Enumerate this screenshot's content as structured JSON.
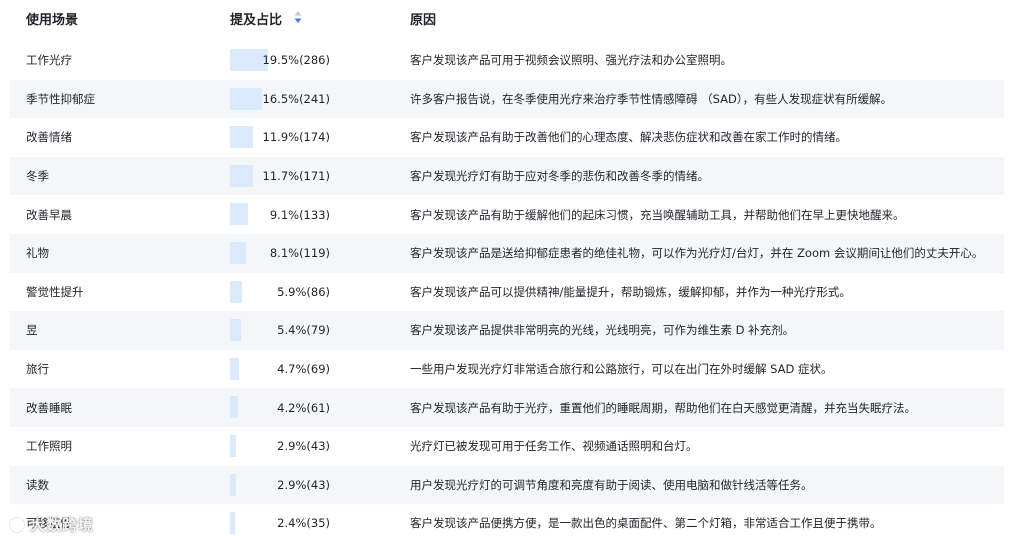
{
  "header": {
    "col_scene": "使用场景",
    "col_share": "提及占比",
    "col_reason": "原因"
  },
  "colors": {
    "bar": "#dbe9fd",
    "sort_up": "#c5c9d1",
    "sort_down": "#3d7cf5",
    "row_shade": "#f5f6f8"
  },
  "watermark": "大数跨境",
  "rows": [
    {
      "scene": "工作光疗",
      "share": "19.5%(286)",
      "percent": 19.5,
      "reason": "客户发现该产品可用于视频会议照明、强光疗法和办公室照明。"
    },
    {
      "scene": "季节性抑郁症",
      "share": "16.5%(241)",
      "percent": 16.5,
      "reason": "许多客户报告说，在冬季使用光疗来治疗季节性情感障碍 （SAD），有些人发现症状有所缓解。"
    },
    {
      "scene": "改善情绪",
      "share": "11.9%(174)",
      "percent": 11.9,
      "reason": "客户发现该产品有助于改善他们的心理态度、解决悲伤症状和改善在家工作时的情绪。"
    },
    {
      "scene": "冬季",
      "share": "11.7%(171)",
      "percent": 11.7,
      "reason": "客户发现光疗灯有助于应对冬季的悲伤和改善冬季的情绪。"
    },
    {
      "scene": "改善早晨",
      "share": "9.1%(133)",
      "percent": 9.1,
      "reason": "客户发现该产品有助于缓解他们的起床习惯，充当唤醒辅助工具，并帮助他们在早上更快地醒来。"
    },
    {
      "scene": "礼物",
      "share": "8.1%(119)",
      "percent": 8.1,
      "reason": "客户发现该产品是送给抑郁症患者的绝佳礼物，可以作为光疗灯/台灯，并在 Zoom 会议期间让他们的丈夫开心。"
    },
    {
      "scene": "警觉性提升",
      "share": "5.9%(86)",
      "percent": 5.9,
      "reason": "客户发现该产品可以提供精神/能量提升，帮助锻炼，缓解抑郁，并作为一种光疗形式。"
    },
    {
      "scene": "昱",
      "share": "5.4%(79)",
      "percent": 5.4,
      "reason": "客户发现该产品提供非常明亮的光线，光线明亮，可作为维生素 D 补充剂。"
    },
    {
      "scene": "旅行",
      "share": "4.7%(69)",
      "percent": 4.7,
      "reason": "一些用户发现光疗灯非常适合旅行和公路旅行，可以在出门在外时缓解 SAD 症状。"
    },
    {
      "scene": "改善睡眠",
      "share": "4.2%(61)",
      "percent": 4.2,
      "reason": "客户发现该产品有助于光疗，重置他们的睡眠周期，帮助他们在白天感觉更清醒，并充当失眠疗法。"
    },
    {
      "scene": "工作照明",
      "share": "2.9%(43)",
      "percent": 2.9,
      "reason": "光疗灯已被发现可用于任务工作、视频通话照明和台灯。"
    },
    {
      "scene": "读数",
      "share": "2.9%(43)",
      "percent": 2.9,
      "reason": "用户发现光疗灯的可调节角度和亮度有助于阅读、使用电脑和做针线活等任务。"
    },
    {
      "scene": "可移植性",
      "share": "2.4%(35)",
      "percent": 2.4,
      "reason": "客户发现该产品便携方便，是一款出色的桌面配件、第二个灯箱，非常适合工作且便于携带。"
    }
  ]
}
